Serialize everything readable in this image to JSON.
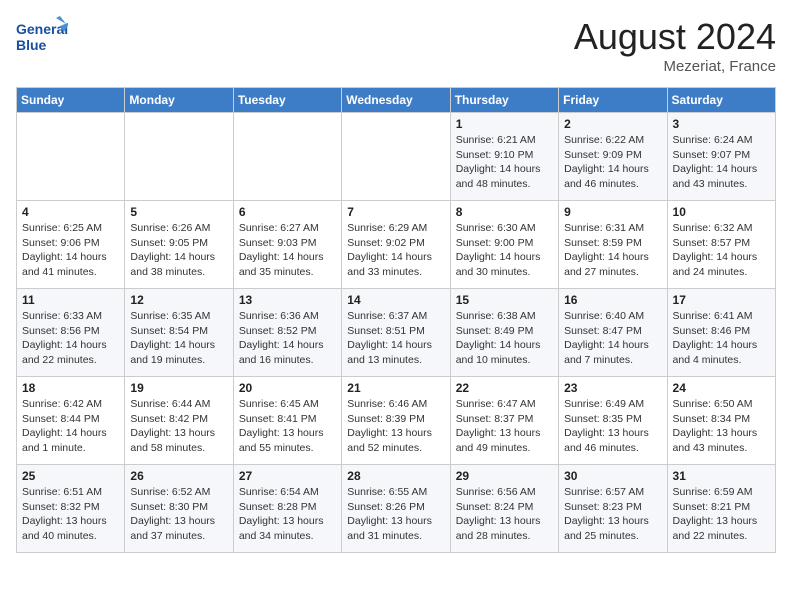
{
  "header": {
    "month_year": "August 2024",
    "location": "Mezeriat, France",
    "logo_line1": "General",
    "logo_line2": "Blue"
  },
  "weekdays": [
    "Sunday",
    "Monday",
    "Tuesday",
    "Wednesday",
    "Thursday",
    "Friday",
    "Saturday"
  ],
  "weeks": [
    [
      {
        "day": "",
        "info": ""
      },
      {
        "day": "",
        "info": ""
      },
      {
        "day": "",
        "info": ""
      },
      {
        "day": "",
        "info": ""
      },
      {
        "day": "1",
        "info": "Sunrise: 6:21 AM\nSunset: 9:10 PM\nDaylight: 14 hours\nand 48 minutes."
      },
      {
        "day": "2",
        "info": "Sunrise: 6:22 AM\nSunset: 9:09 PM\nDaylight: 14 hours\nand 46 minutes."
      },
      {
        "day": "3",
        "info": "Sunrise: 6:24 AM\nSunset: 9:07 PM\nDaylight: 14 hours\nand 43 minutes."
      }
    ],
    [
      {
        "day": "4",
        "info": "Sunrise: 6:25 AM\nSunset: 9:06 PM\nDaylight: 14 hours\nand 41 minutes."
      },
      {
        "day": "5",
        "info": "Sunrise: 6:26 AM\nSunset: 9:05 PM\nDaylight: 14 hours\nand 38 minutes."
      },
      {
        "day": "6",
        "info": "Sunrise: 6:27 AM\nSunset: 9:03 PM\nDaylight: 14 hours\nand 35 minutes."
      },
      {
        "day": "7",
        "info": "Sunrise: 6:29 AM\nSunset: 9:02 PM\nDaylight: 14 hours\nand 33 minutes."
      },
      {
        "day": "8",
        "info": "Sunrise: 6:30 AM\nSunset: 9:00 PM\nDaylight: 14 hours\nand 30 minutes."
      },
      {
        "day": "9",
        "info": "Sunrise: 6:31 AM\nSunset: 8:59 PM\nDaylight: 14 hours\nand 27 minutes."
      },
      {
        "day": "10",
        "info": "Sunrise: 6:32 AM\nSunset: 8:57 PM\nDaylight: 14 hours\nand 24 minutes."
      }
    ],
    [
      {
        "day": "11",
        "info": "Sunrise: 6:33 AM\nSunset: 8:56 PM\nDaylight: 14 hours\nand 22 minutes."
      },
      {
        "day": "12",
        "info": "Sunrise: 6:35 AM\nSunset: 8:54 PM\nDaylight: 14 hours\nand 19 minutes."
      },
      {
        "day": "13",
        "info": "Sunrise: 6:36 AM\nSunset: 8:52 PM\nDaylight: 14 hours\nand 16 minutes."
      },
      {
        "day": "14",
        "info": "Sunrise: 6:37 AM\nSunset: 8:51 PM\nDaylight: 14 hours\nand 13 minutes."
      },
      {
        "day": "15",
        "info": "Sunrise: 6:38 AM\nSunset: 8:49 PM\nDaylight: 14 hours\nand 10 minutes."
      },
      {
        "day": "16",
        "info": "Sunrise: 6:40 AM\nSunset: 8:47 PM\nDaylight: 14 hours\nand 7 minutes."
      },
      {
        "day": "17",
        "info": "Sunrise: 6:41 AM\nSunset: 8:46 PM\nDaylight: 14 hours\nand 4 minutes."
      }
    ],
    [
      {
        "day": "18",
        "info": "Sunrise: 6:42 AM\nSunset: 8:44 PM\nDaylight: 14 hours\nand 1 minute."
      },
      {
        "day": "19",
        "info": "Sunrise: 6:44 AM\nSunset: 8:42 PM\nDaylight: 13 hours\nand 58 minutes."
      },
      {
        "day": "20",
        "info": "Sunrise: 6:45 AM\nSunset: 8:41 PM\nDaylight: 13 hours\nand 55 minutes."
      },
      {
        "day": "21",
        "info": "Sunrise: 6:46 AM\nSunset: 8:39 PM\nDaylight: 13 hours\nand 52 minutes."
      },
      {
        "day": "22",
        "info": "Sunrise: 6:47 AM\nSunset: 8:37 PM\nDaylight: 13 hours\nand 49 minutes."
      },
      {
        "day": "23",
        "info": "Sunrise: 6:49 AM\nSunset: 8:35 PM\nDaylight: 13 hours\nand 46 minutes."
      },
      {
        "day": "24",
        "info": "Sunrise: 6:50 AM\nSunset: 8:34 PM\nDaylight: 13 hours\nand 43 minutes."
      }
    ],
    [
      {
        "day": "25",
        "info": "Sunrise: 6:51 AM\nSunset: 8:32 PM\nDaylight: 13 hours\nand 40 minutes."
      },
      {
        "day": "26",
        "info": "Sunrise: 6:52 AM\nSunset: 8:30 PM\nDaylight: 13 hours\nand 37 minutes."
      },
      {
        "day": "27",
        "info": "Sunrise: 6:54 AM\nSunset: 8:28 PM\nDaylight: 13 hours\nand 34 minutes."
      },
      {
        "day": "28",
        "info": "Sunrise: 6:55 AM\nSunset: 8:26 PM\nDaylight: 13 hours\nand 31 minutes."
      },
      {
        "day": "29",
        "info": "Sunrise: 6:56 AM\nSunset: 8:24 PM\nDaylight: 13 hours\nand 28 minutes."
      },
      {
        "day": "30",
        "info": "Sunrise: 6:57 AM\nSunset: 8:23 PM\nDaylight: 13 hours\nand 25 minutes."
      },
      {
        "day": "31",
        "info": "Sunrise: 6:59 AM\nSunset: 8:21 PM\nDaylight: 13 hours\nand 22 minutes."
      }
    ]
  ]
}
